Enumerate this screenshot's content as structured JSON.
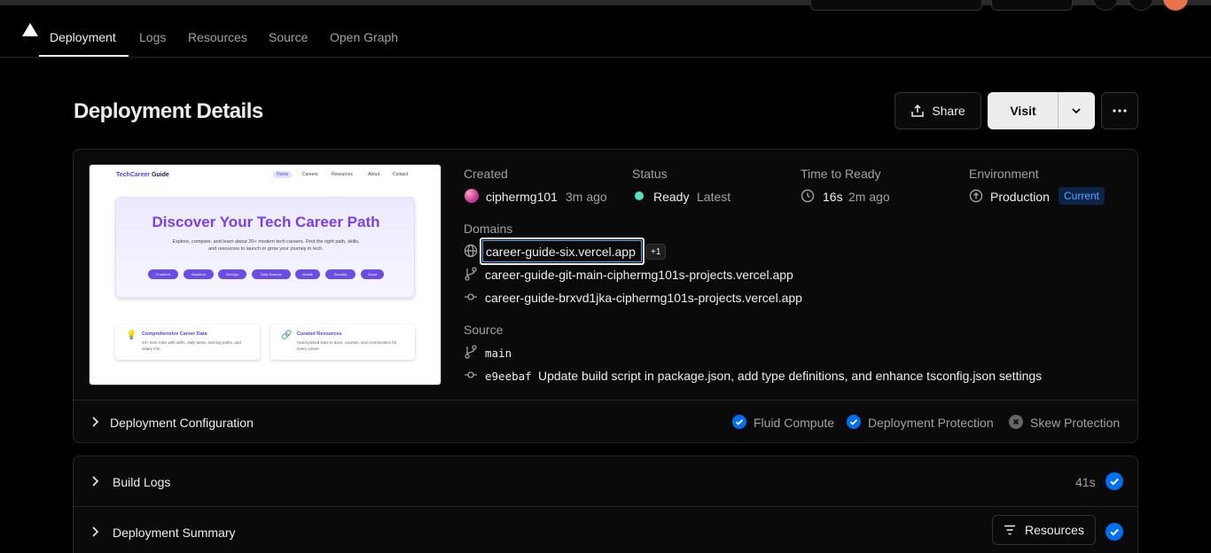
{
  "nav": {
    "tabs": [
      {
        "label": "Deployment"
      },
      {
        "label": "Logs"
      },
      {
        "label": "Resources"
      },
      {
        "label": "Source"
      },
      {
        "label": "Open Graph"
      }
    ]
  },
  "header": {
    "title": "Deployment Details",
    "share_label": "Share",
    "visit_label": "Visit"
  },
  "preview": {
    "brand_a": "TechCareer",
    "brand_b": " Guide",
    "nav": [
      "Home",
      "Careers",
      "Resources",
      "About",
      "Contact"
    ],
    "hero_title": "Discover Your Tech Career Path",
    "hero_sub": "Explore, compare, and learn about 20+ modern tech careers. Find the right path, skills, and resources to launch or grow your journey in tech.",
    "chips": [
      "Frontend",
      "Backend",
      "DevOps",
      "Data Science",
      "Mobile",
      "Security",
      "Cloud"
    ],
    "card1_title": "Comprehensive Career Data",
    "card1_text": "20+ tech roles with skills, daily tasks, earning paths, and salary info",
    "card2_title": "Curated Resources",
    "card2_text": "Hand-picked links to docs, courses, and communities for every career"
  },
  "details": {
    "created_label": "Created",
    "created_user": "ciphermg101",
    "created_time": "3m ago",
    "status_label": "Status",
    "status_value": "Ready",
    "status_tag": "Latest",
    "ttr_label": "Time to Ready",
    "ttr_value": "16s",
    "ttr_time": "2m ago",
    "env_label": "Environment",
    "env_value": "Production",
    "env_badge": "Current",
    "domains_label": "Domains",
    "domain_primary": "career-guide-six.vercel.app",
    "domain_more": "+1",
    "domain_branch": "career-guide-git-main-ciphermg101s-projects.vercel.app",
    "domain_commit": "career-guide-brxvd1jka-ciphermg101s-projects.vercel.app",
    "source_label": "Source",
    "source_branch": "main",
    "commit_hash": "e9eebaf",
    "commit_message": "Update build script in package.json, add type definitions, and enhance tsconfig.json settings"
  },
  "config": {
    "title": "Deployment Configuration",
    "fluid": "Fluid Compute",
    "protection": "Deployment Protection",
    "skew": "Skew Protection"
  },
  "build_logs": {
    "title": "Build Logs",
    "duration": "41s"
  },
  "summary": {
    "title": "Deployment Summary",
    "resources_label": "Resources"
  },
  "colors": {
    "background": "#000000",
    "accent_blue": "#0070f3",
    "ready_green": "#50e3c2"
  }
}
